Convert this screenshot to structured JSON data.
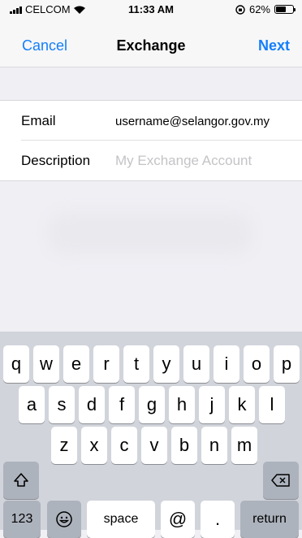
{
  "status_bar": {
    "carrier": "CELCOM",
    "time": "11:33 AM",
    "battery_percent_label": "62%",
    "battery_level": 0.62
  },
  "nav": {
    "cancel_label": "Cancel",
    "title": "Exchange",
    "next_label": "Next"
  },
  "form": {
    "email_label": "Email",
    "email_value": "username@selangor.gov.my",
    "description_label": "Description",
    "description_placeholder": "My Exchange Account"
  },
  "keyboard": {
    "row1": [
      "q",
      "w",
      "e",
      "r",
      "t",
      "y",
      "u",
      "i",
      "o",
      "p"
    ],
    "row2": [
      "a",
      "s",
      "d",
      "f",
      "g",
      "h",
      "j",
      "k",
      "l"
    ],
    "row3": [
      "z",
      "x",
      "c",
      "v",
      "b",
      "n",
      "m"
    ],
    "numbers_label": "123",
    "space_label": "space",
    "at_label": "@",
    "dot_label": ".",
    "return_label": "return"
  },
  "colors": {
    "accent": "#147efb",
    "keyboard_bg": "#d1d4db",
    "special_key": "#adb3bd"
  }
}
